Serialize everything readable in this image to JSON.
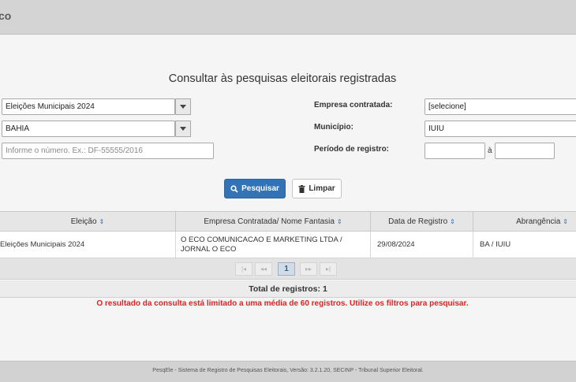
{
  "header": {
    "brand": "co"
  },
  "page": {
    "title": "Consultar às pesquisas eleitorais registradas"
  },
  "form": {
    "eleicao_value": "Eleições Municipais 2024",
    "uf_value": "BAHIA",
    "numero_placeholder": "Informe o número. Ex.: DF-55555/2016",
    "empresa_label": "Empresa contratada:",
    "empresa_value": "[selecione]",
    "municipio_label": "Município:",
    "municipio_value": "IUIU",
    "periodo_label": "Período de registro:",
    "periodo_sep": "à",
    "search_label": "Pesquisar",
    "clear_label": "Limpar"
  },
  "table": {
    "columns": [
      "Eleição",
      "Empresa Contratada/ Nome Fantasia",
      "Data de Registro",
      "Abrangência"
    ],
    "sort_icon": "⇕",
    "rows": [
      [
        "Eleições Municipais 2024",
        "O ECO COMUNICACAO E MARKETING LTDA / JORNAL O ECO",
        "29/08/2024",
        "BA / IUIU"
      ]
    ]
  },
  "pagination": {
    "first": "|◂",
    "prev": "◂◂",
    "current": "1",
    "next": "▸▸",
    "last": "▸|"
  },
  "totals": {
    "label": "Total de registros: 1"
  },
  "warning": "O resultado da consulta está limitado a uma média de 60 registros. Utilize os filtros para pesquisar.",
  "footer": "PesqEle - Sistema de Registro de Pesquisas Eleitorais, Versão: 3.2.1.20, SECINP - Tribunal Superior Eleitoral.",
  "colors": {
    "primary": "#3373b5",
    "warning": "#dd2222"
  }
}
